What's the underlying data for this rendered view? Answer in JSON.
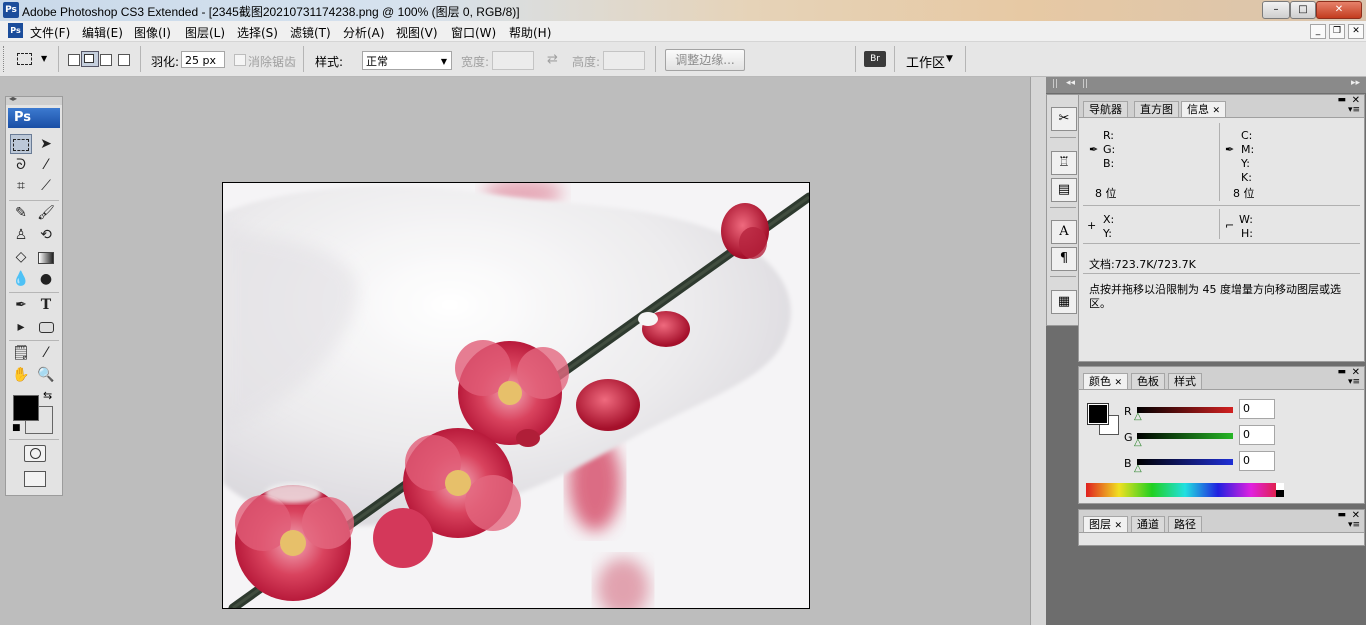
{
  "window": {
    "title": "Adobe Photoshop CS3 Extended - [2345截图20210731174238.png @ 100% (图层 0, RGB/8)]",
    "app_icon": "Ps",
    "controls": {
      "minimize": "–",
      "maximize": "□",
      "close": "✕"
    }
  },
  "menubar": {
    "items": [
      "文件(F)",
      "编辑(E)",
      "图像(I)",
      "图层(L)",
      "选择(S)",
      "滤镜(T)",
      "分析(A)",
      "视图(V)",
      "窗口(W)",
      "帮助(H)"
    ],
    "doc_controls": {
      "minimize": "_",
      "restore": "❐",
      "close": "✕"
    }
  },
  "options": {
    "feather_label": "羽化:",
    "feather_value": "25 px",
    "antialias_label": "消除锯齿",
    "style_label": "样式:",
    "style_value": "正常",
    "width_label": "宽度:",
    "height_label": "高度:",
    "refine_edge_label": "调整边缘...",
    "workspace_label": "工作区"
  },
  "tools": {
    "logo": "Ps",
    "text_tool_glyph": "T"
  },
  "info_panel": {
    "tabs": [
      "导航器",
      "直方图",
      "信息"
    ],
    "active_tab": 2,
    "rgb_labels": [
      "R:",
      "G:",
      "B:"
    ],
    "cmyk_labels": [
      "C:",
      "M:",
      "Y:",
      "K:"
    ],
    "bit_left": "8 位",
    "bit_right": "8 位",
    "x_label": "X:",
    "y_label": "Y:",
    "w_label": "W:",
    "h_label": "H:",
    "doc_size": "文档:723.7K/723.7K",
    "hint": "点按并拖移以沿限制为 45 度增量方向移动图层或选区。"
  },
  "color_panel": {
    "tabs": [
      "颜色",
      "色板",
      "样式"
    ],
    "active_tab": 0,
    "channels": [
      {
        "label": "R",
        "value": "0",
        "color": "#d22020"
      },
      {
        "label": "G",
        "value": "0",
        "color": "#26b626"
      },
      {
        "label": "B",
        "value": "0",
        "color": "#1f2fd6"
      }
    ]
  },
  "layers_panel": {
    "tabs": [
      "图层",
      "通道",
      "路径"
    ],
    "active_tab": 0
  },
  "colors": {
    "foreground": "#000000",
    "background": "#ffffff"
  }
}
